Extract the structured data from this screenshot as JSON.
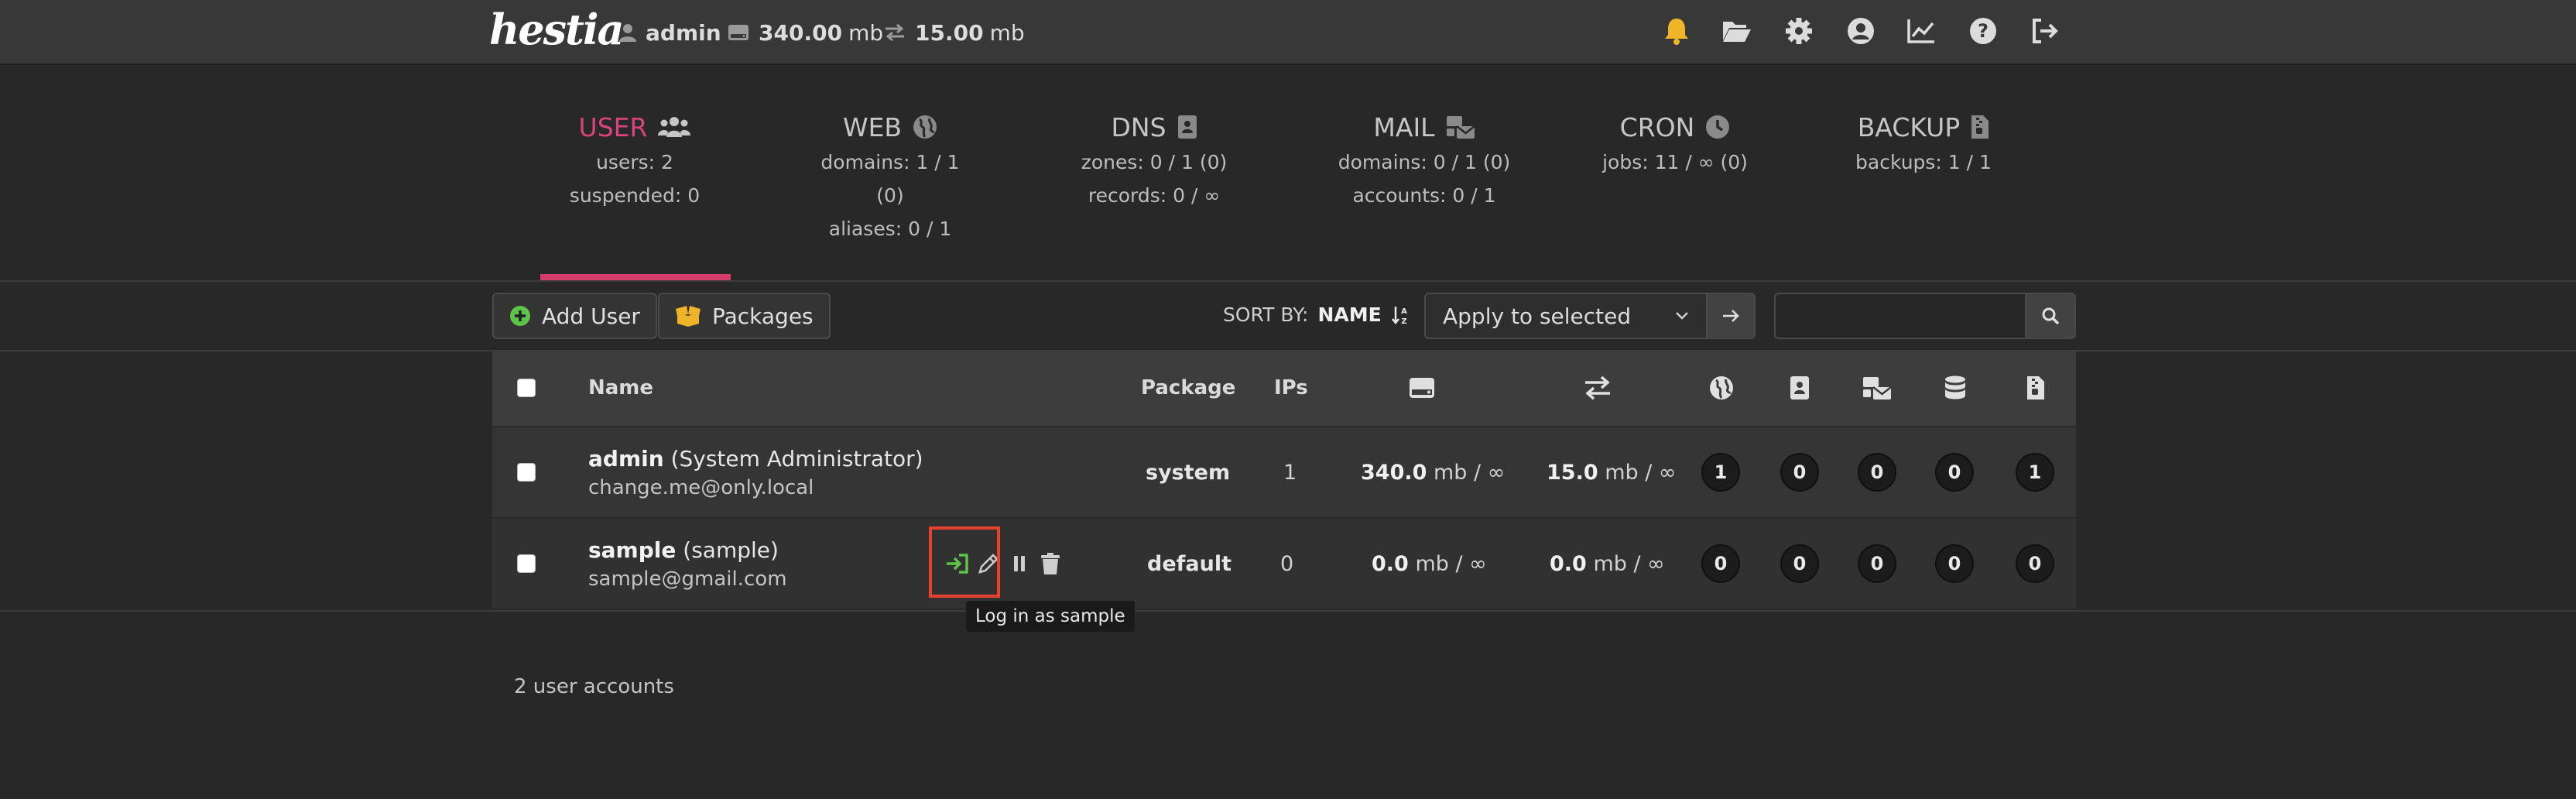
{
  "topbar": {
    "logo": "hestia",
    "user": "admin",
    "disk": "340.00",
    "disk_unit": "mb",
    "bandwidth": "15.00",
    "bandwidth_unit": "mb",
    "icons": [
      "bell-icon",
      "folder-open-icon",
      "gear-icon",
      "user-circle-icon",
      "chart-line-icon",
      "help-icon",
      "logout-icon"
    ]
  },
  "summary": [
    {
      "title": "USER",
      "icon": "users-icon",
      "lines": [
        "users: 2",
        "suspended: 0"
      ],
      "active": true
    },
    {
      "title": "WEB",
      "icon": "globe-icon",
      "lines": [
        "domains: 1 / 1 (0)",
        "aliases: 0 / 1"
      ]
    },
    {
      "title": "DNS",
      "icon": "address-book-icon",
      "lines": [
        "zones: 0 / 1 (0)",
        "records: 0 / ∞"
      ]
    },
    {
      "title": "MAIL",
      "icon": "mail-bulk-icon",
      "lines": [
        "domains: 0 / 1 (0)",
        "accounts: 0 / 1"
      ]
    },
    {
      "title": "CRON",
      "icon": "clock-icon",
      "lines": [
        "jobs: 11 / ∞ (0)"
      ]
    },
    {
      "title": "BACKUP",
      "icon": "file-archive-icon",
      "lines": [
        "backups: 1 / 1"
      ]
    }
  ],
  "toolbar": {
    "add_user": "Add User",
    "packages": "Packages",
    "sort_by_label": "SORT BY:",
    "sort_by_value": "NAME",
    "apply_select": "Apply to selected",
    "search_placeholder": ""
  },
  "table": {
    "headers": {
      "name": "Name",
      "package": "Package",
      "ips": "IPs"
    },
    "rows": [
      {
        "username": "admin",
        "fullname": "(System Administrator)",
        "email": "change.me@only.local",
        "package": "system",
        "ips": "1",
        "disk": "340.0",
        "disk_rest": "mb / ∞",
        "bandwidth": "15.0",
        "bandwidth_rest": "mb / ∞",
        "web": "1",
        "dns": "0",
        "mail": "0",
        "db": "0",
        "backup": "1"
      },
      {
        "username": "sample",
        "fullname": "(sample)",
        "email": "sample@gmail.com",
        "package": "default",
        "ips": "0",
        "disk": "0.0",
        "disk_rest": "mb / ∞",
        "bandwidth": "0.0",
        "bandwidth_rest": "mb / ∞",
        "web": "0",
        "dns": "0",
        "mail": "0",
        "db": "0",
        "backup": "0"
      }
    ]
  },
  "tooltip": "Log in as sample",
  "footer": "2 user accounts",
  "colors": {
    "accent": "#d43c6c",
    "login_green": "#5fc24b",
    "bell_yellow": "#f0b429",
    "highlight_red": "#e5412d"
  }
}
